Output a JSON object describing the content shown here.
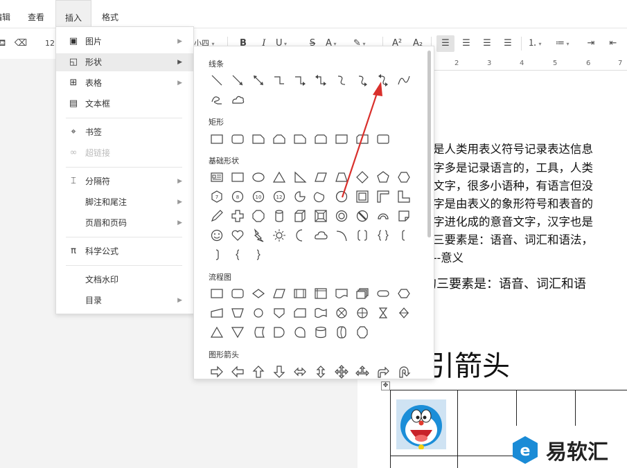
{
  "menubar": {
    "items": [
      "编辑",
      "查看",
      "插入",
      "格式"
    ]
  },
  "toolbar": {
    "font_size": "12",
    "font_size_name": "小四",
    "bold": "B",
    "italic": "I",
    "underline": "U",
    "strike": "S",
    "font_color": "A",
    "superscript": "A²",
    "subscript": "A₂"
  },
  "ruler": {
    "ticks": [
      "2",
      "3",
      "4",
      "5",
      "6",
      "7"
    ]
  },
  "insert_menu": {
    "items": [
      {
        "label": "图片",
        "icon": "image-icon",
        "glyph": "▣",
        "has_submenu": true
      },
      {
        "label": "形状",
        "icon": "shape-icon",
        "glyph": "◱",
        "has_submenu": true
      },
      {
        "label": "表格",
        "icon": "table-icon",
        "glyph": "⊞",
        "has_submenu": true
      },
      {
        "label": "文本框",
        "icon": "textbox-icon",
        "glyph": "▤",
        "has_submenu": false
      },
      {
        "label": "书签",
        "icon": "bookmark-icon",
        "glyph": "⌖",
        "has_submenu": false
      },
      {
        "label": "超链接",
        "icon": "link-icon",
        "glyph": "∞",
        "has_submenu": false,
        "disabled": true
      },
      {
        "label": "分隔符",
        "icon": "separator-icon",
        "glyph": "⌶",
        "has_submenu": true
      },
      {
        "label": "脚注和尾注",
        "icon": "",
        "glyph": "",
        "has_submenu": true
      },
      {
        "label": "页眉和页码",
        "icon": "",
        "glyph": "",
        "has_submenu": true
      },
      {
        "label": "科学公式",
        "icon": "pi-icon",
        "glyph": "π",
        "has_submenu": false
      },
      {
        "label": "文档水印",
        "icon": "",
        "glyph": "",
        "has_submenu": false
      },
      {
        "label": "目录",
        "icon": "",
        "glyph": "",
        "has_submenu": true
      }
    ]
  },
  "shapes_panel": {
    "sections": [
      "线条",
      "矩形",
      "基础形状",
      "流程图",
      "图形箭头"
    ],
    "numbered_labels": [
      "7",
      "8",
      "10",
      "12"
    ]
  },
  "document": {
    "lines": [
      "是人类用表义符号记录表达信息",
      "字多是记录语言的，工具，人类",
      "文字，很多小语种，有语言但没",
      "字是由表义的象形符号和表音的",
      "字进化成的意音文字，汉字也是",
      "三要素是：语音、词汇和语法，",
      "--意义"
    ],
    "line2": "的三要素是：语音、词汇和语",
    "heading": "引箭头"
  },
  "watermark": {
    "text": "易软汇"
  },
  "colors": {
    "accent_red": "#d9302c",
    "watermark_blue": "#1a8bd6"
  }
}
